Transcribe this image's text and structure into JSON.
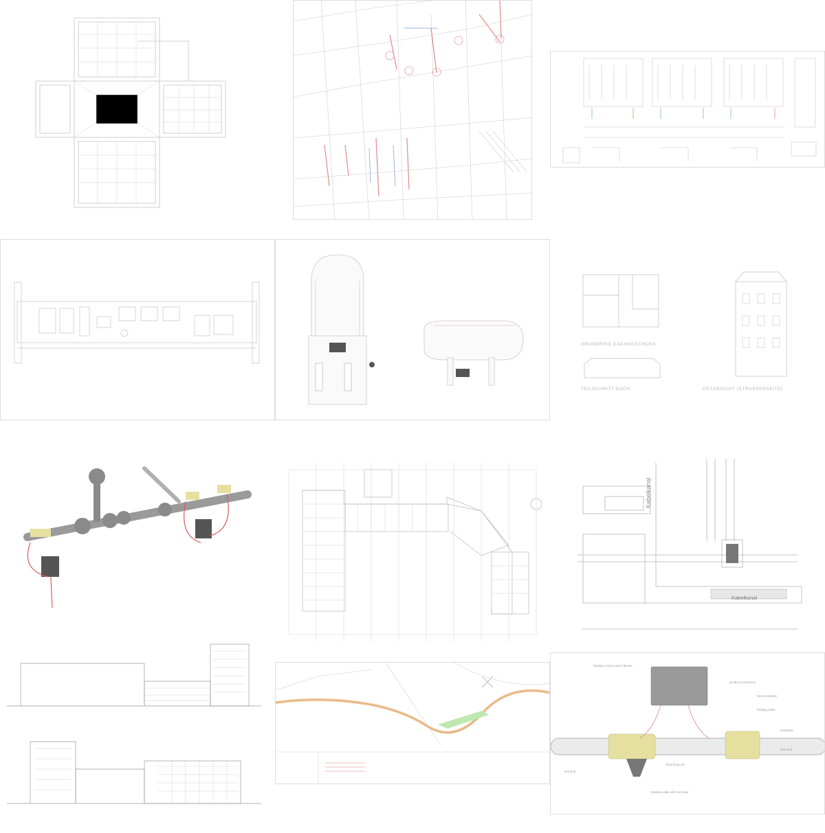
{
  "tile_6": {
    "label_plan": "GRUNDRISS DACHGESCHOSS",
    "label_section": "TEILSCHNITT DACH",
    "label_elevation": "OSTANSICHT (STRASSENSEITE)"
  },
  "tile_9": {
    "label_top": "Kabelkanal",
    "label_bottom": "Kabelkanal"
  },
  "tile_12": {
    "tags": [
      "heating circuit control device",
      "product connection",
      "heat insulation",
      "heating cable",
      "insulation",
      "end seal",
      "fixed heat set",
      "end bell",
      "heating cable with end seal"
    ]
  },
  "colors": {
    "line": "#c9c9c9",
    "heat": "#e06060",
    "pipe": "#bdbdbd"
  }
}
